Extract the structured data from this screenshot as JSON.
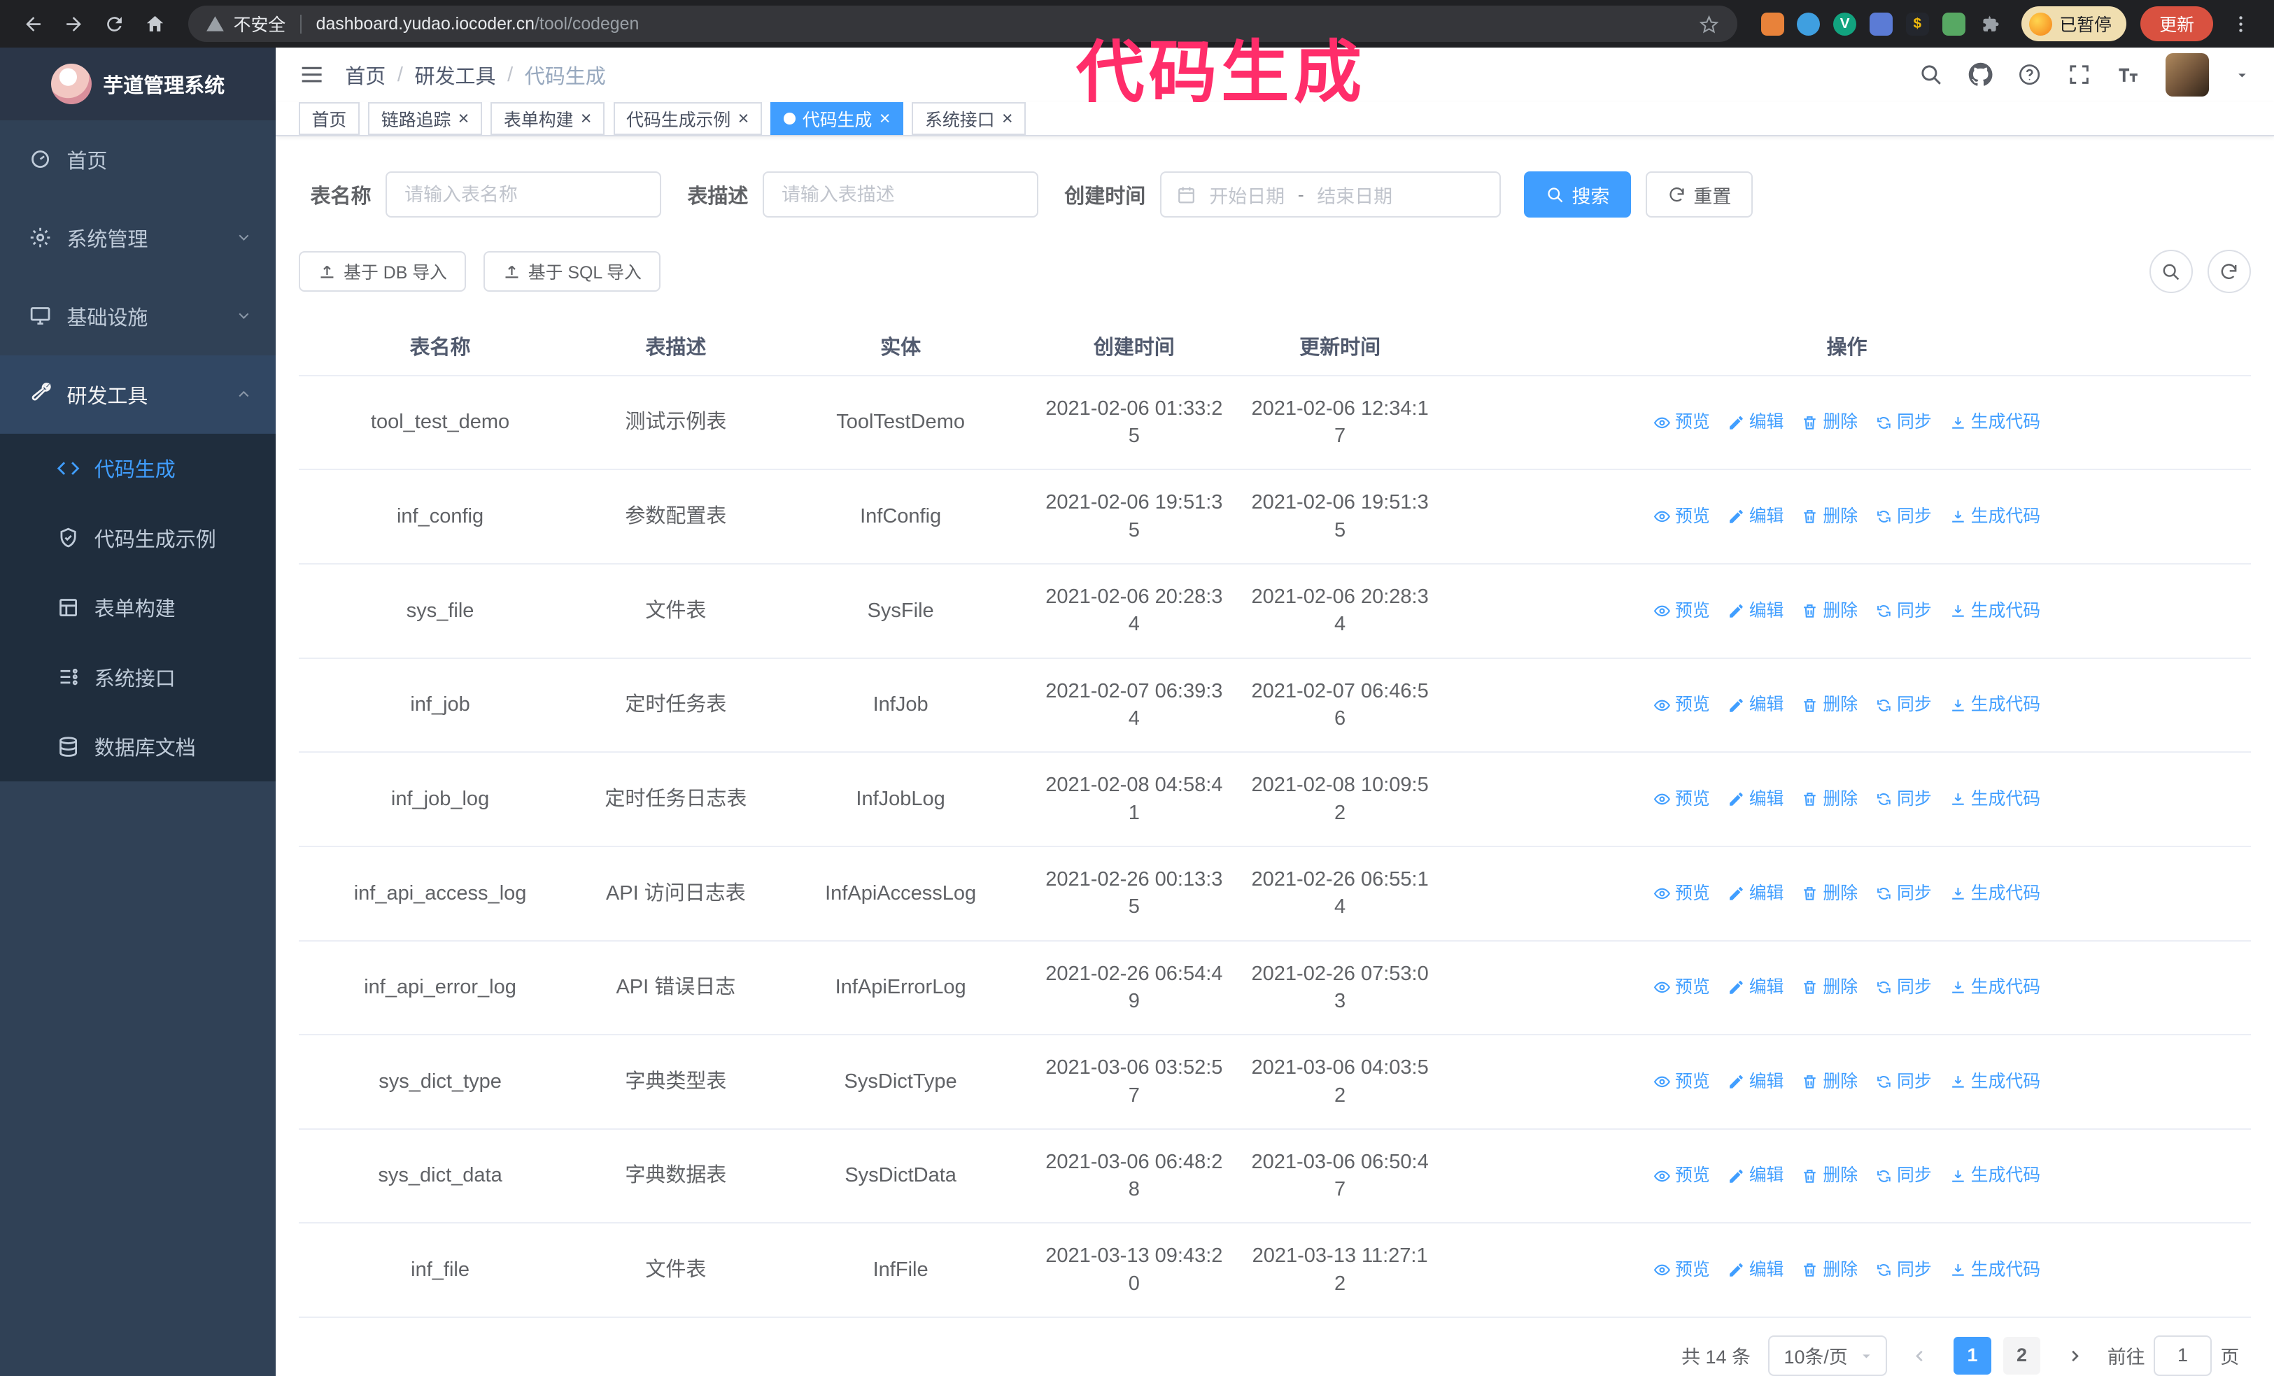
{
  "colors": {
    "primary": "#409eff",
    "sidebar_bg": "#304156",
    "submenu_bg": "#1f2d3d",
    "annotation": "#ff2d6a",
    "chrome_bg": "#202124",
    "update_button_bg": "#d95140"
  },
  "annotation": {
    "text": "代码生成"
  },
  "browser": {
    "nav_icons": [
      "back",
      "forward",
      "reload",
      "home"
    ],
    "security_label": "不安全",
    "url_host": "dashboard.yudao.iocoder.cn",
    "url_path": "/tool/codegen",
    "extension_icons": [
      {
        "name": "password-manager-extension",
        "color": "#e8823a",
        "shape": "square",
        "glyph": ""
      },
      {
        "name": "translate-extension",
        "color": "#3f9fe0",
        "shape": "circle",
        "glyph": ""
      },
      {
        "name": "checker-extension",
        "color": "#12a37f",
        "shape": "circle",
        "glyph": "V"
      },
      {
        "name": "people-extension",
        "color": "#5b7bd5",
        "shape": "square",
        "glyph": ""
      },
      {
        "name": "wallet-extension",
        "color": "#23262d",
        "shape": "square",
        "glyph": "$"
      },
      {
        "name": "nature-extension",
        "color": "#57a863",
        "shape": "square",
        "glyph": ""
      },
      {
        "name": "extensions-puzzle",
        "color": "#9aa0a6",
        "shape": "puzzle",
        "glyph": ""
      }
    ],
    "profile_badge": "已暂停",
    "update_button": "更新"
  },
  "sidebar": {
    "logo_title": "芋道管理系统",
    "menu": [
      {
        "key": "home",
        "label": "首页",
        "icon": "dashboard",
        "chevron": null,
        "open": false
      },
      {
        "key": "system",
        "label": "系统管理",
        "icon": "gear",
        "chevron": "down",
        "open": false
      },
      {
        "key": "infra",
        "label": "基础设施",
        "icon": "monitor",
        "chevron": "down",
        "open": false
      },
      {
        "key": "devtools",
        "label": "研发工具",
        "icon": "tools",
        "chevron": "up",
        "open": true
      }
    ],
    "submenu": [
      {
        "key": "codegen",
        "label": "代码生成",
        "icon": "code",
        "active": true
      },
      {
        "key": "codegen-example",
        "label": "代码生成示例",
        "icon": "example",
        "active": false
      },
      {
        "key": "form-builder",
        "label": "表单构建",
        "icon": "form",
        "active": false
      },
      {
        "key": "api",
        "label": "系统接口",
        "icon": "api",
        "active": false
      },
      {
        "key": "db-doc",
        "label": "数据库文档",
        "icon": "database",
        "active": false
      }
    ]
  },
  "header": {
    "breadcrumb": [
      "首页",
      "研发工具",
      "代码生成"
    ],
    "breadcrumb_separator": "/",
    "icons": [
      "search",
      "github",
      "question",
      "fullscreen",
      "fontsize"
    ]
  },
  "tabs": [
    {
      "key": "home",
      "label": "首页",
      "closable": false,
      "active": false
    },
    {
      "key": "tracer",
      "label": "链路追踪",
      "closable": true,
      "active": false
    },
    {
      "key": "form-builder",
      "label": "表单构建",
      "closable": true,
      "active": false
    },
    {
      "key": "codegen-example",
      "label": "代码生成示例",
      "closable": true,
      "active": false
    },
    {
      "key": "codegen",
      "label": "代码生成",
      "closable": true,
      "active": true
    },
    {
      "key": "api",
      "label": "系统接口",
      "closable": true,
      "active": false
    }
  ],
  "filters": {
    "table_name_label": "表名称",
    "table_name_placeholder": "请输入表名称",
    "table_desc_label": "表描述",
    "table_desc_placeholder": "请输入表描述",
    "create_time_label": "创建时间",
    "date_start_placeholder": "开始日期",
    "date_separator": "-",
    "date_end_placeholder": "结束日期",
    "search_button": "搜索",
    "reset_button": "重置"
  },
  "toolbar": {
    "import_db_label": "基于 DB 导入",
    "import_sql_label": "基于 SQL 导入"
  },
  "table": {
    "columns": [
      "表名称",
      "表描述",
      "实体",
      "创建时间",
      "更新时间",
      "操作"
    ],
    "actions": [
      {
        "key": "preview",
        "label": "预览",
        "icon": "eye"
      },
      {
        "key": "edit",
        "label": "编辑",
        "icon": "edit"
      },
      {
        "key": "delete",
        "label": "删除",
        "icon": "delete"
      },
      {
        "key": "sync",
        "label": "同步",
        "icon": "sync"
      },
      {
        "key": "generate-code",
        "label": "生成代码",
        "icon": "download"
      }
    ],
    "rows": [
      {
        "name": "tool_test_demo",
        "desc": "测试示例表",
        "entity": "ToolTestDemo",
        "created": "2021-02-06 01:33:25",
        "updated": "2021-02-06 12:34:17"
      },
      {
        "name": "inf_config",
        "desc": "参数配置表",
        "entity": "InfConfig",
        "created": "2021-02-06 19:51:35",
        "updated": "2021-02-06 19:51:35"
      },
      {
        "name": "sys_file",
        "desc": "文件表",
        "entity": "SysFile",
        "created": "2021-02-06 20:28:34",
        "updated": "2021-02-06 20:28:34"
      },
      {
        "name": "inf_job",
        "desc": "定时任务表",
        "entity": "InfJob",
        "created": "2021-02-07 06:39:34",
        "updated": "2021-02-07 06:46:56"
      },
      {
        "name": "inf_job_log",
        "desc": "定时任务日志表",
        "entity": "InfJobLog",
        "created": "2021-02-08 04:58:41",
        "updated": "2021-02-08 10:09:52"
      },
      {
        "name": "inf_api_access_log",
        "desc": "API 访问日志表",
        "entity": "InfApiAccessLog",
        "created": "2021-02-26 00:13:35",
        "updated": "2021-02-26 06:55:14"
      },
      {
        "name": "inf_api_error_log",
        "desc": "API 错误日志",
        "entity": "InfApiErrorLog",
        "created": "2021-02-26 06:54:49",
        "updated": "2021-02-26 07:53:03"
      },
      {
        "name": "sys_dict_type",
        "desc": "字典类型表",
        "entity": "SysDictType",
        "created": "2021-03-06 03:52:57",
        "updated": "2021-03-06 04:03:52"
      },
      {
        "name": "sys_dict_data",
        "desc": "字典数据表",
        "entity": "SysDictData",
        "created": "2021-03-06 06:48:28",
        "updated": "2021-03-06 06:50:47"
      },
      {
        "name": "inf_file",
        "desc": "文件表",
        "entity": "InfFile",
        "created": "2021-03-13 09:43:20",
        "updated": "2021-03-13 11:27:12"
      }
    ]
  },
  "pagination": {
    "total_label": "共 14 条",
    "page_size": "10条/页",
    "pages": [
      "1",
      "2"
    ],
    "active_page": "1",
    "goto_prefix": "前往",
    "goto_value": "1",
    "goto_suffix": "页"
  }
}
